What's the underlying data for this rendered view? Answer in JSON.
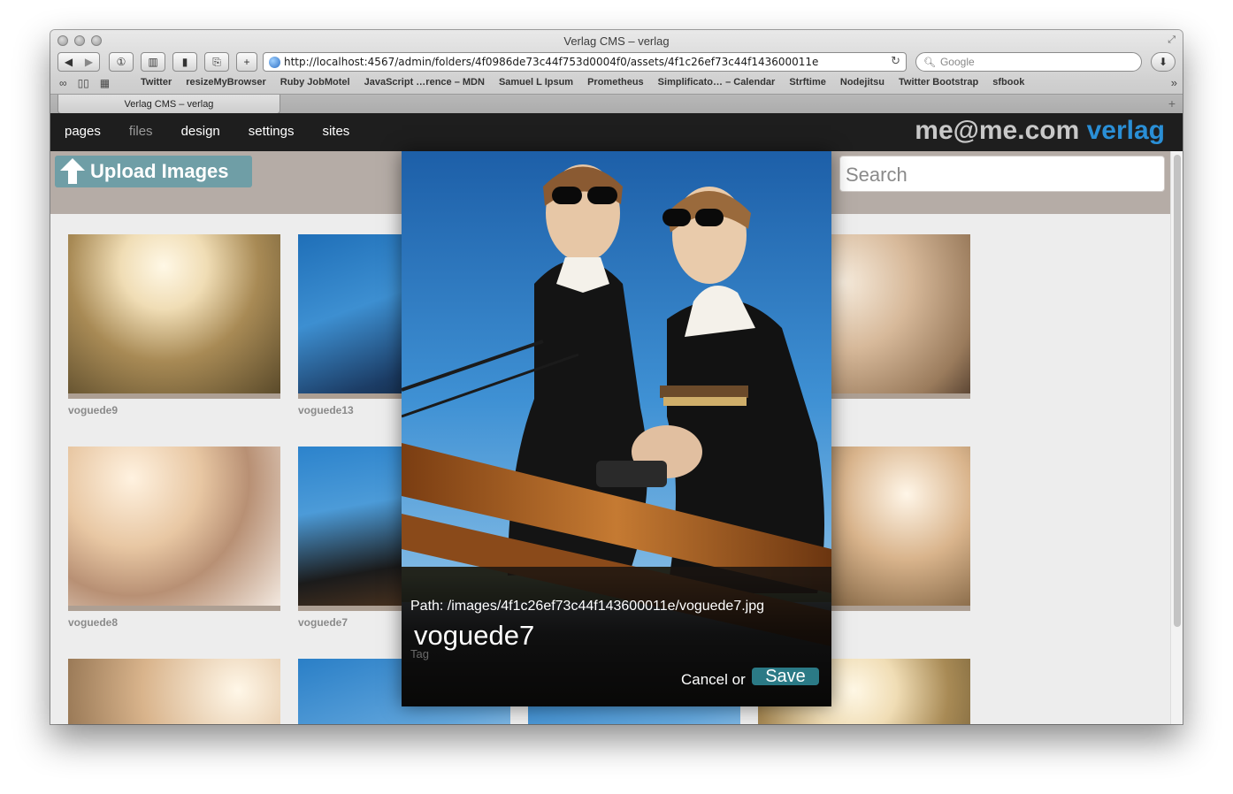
{
  "browser": {
    "window_title": "Verlag CMS – verlag",
    "url": "http://localhost:4567/admin/folders/4f0986de73c44f753d0004f0/assets/4f1c26ef73c44f143600011e",
    "search_placeholder": "Google",
    "bookmarks": [
      "Twitter",
      "resizeMyBrowser",
      "Ruby JobMotel",
      "JavaScript …rence – MDN",
      "Samuel L Ipsum",
      "Prometheus",
      "Simplificato… – Calendar",
      "Strftime",
      "Nodejitsu",
      "Twitter Bootstrap",
      "sfbook"
    ],
    "tab_title": "Verlag CMS – verlag",
    "icons": {
      "back": "back-arrow-icon",
      "forward": "forward-arrow-icon",
      "reader": "reader-icon",
      "add_bookmark": "plus-icon",
      "reload": "reload-icon",
      "downloads": "download-icon"
    }
  },
  "nav": {
    "items": [
      "pages",
      "files",
      "design",
      "settings",
      "sites"
    ],
    "brand_part1": "me@me.com",
    "brand_part2": "verlag"
  },
  "toolbar": {
    "upload_label": "Upload Images",
    "search_placeholder": "Search"
  },
  "gallery": {
    "items": [
      {
        "label": "voguede9"
      },
      {
        "label": "voguede13"
      },
      {
        "label": "voguede8"
      },
      {
        "label": "voguede7"
      }
    ]
  },
  "modal": {
    "path": "Path: /images/4f1c26ef73c44f143600011e/voguede7.jpg",
    "name": "voguede7",
    "tag_placeholder": "Tag",
    "cancel_label": "Cancel or",
    "save_label": "Save"
  },
  "colors": {
    "nav_bg": "#1e1e1e",
    "brand_accent": "#2a8fd6",
    "upload_button": "#6f9ea6",
    "save_button": "#2b7a86",
    "top_band": "#b5aca6"
  }
}
